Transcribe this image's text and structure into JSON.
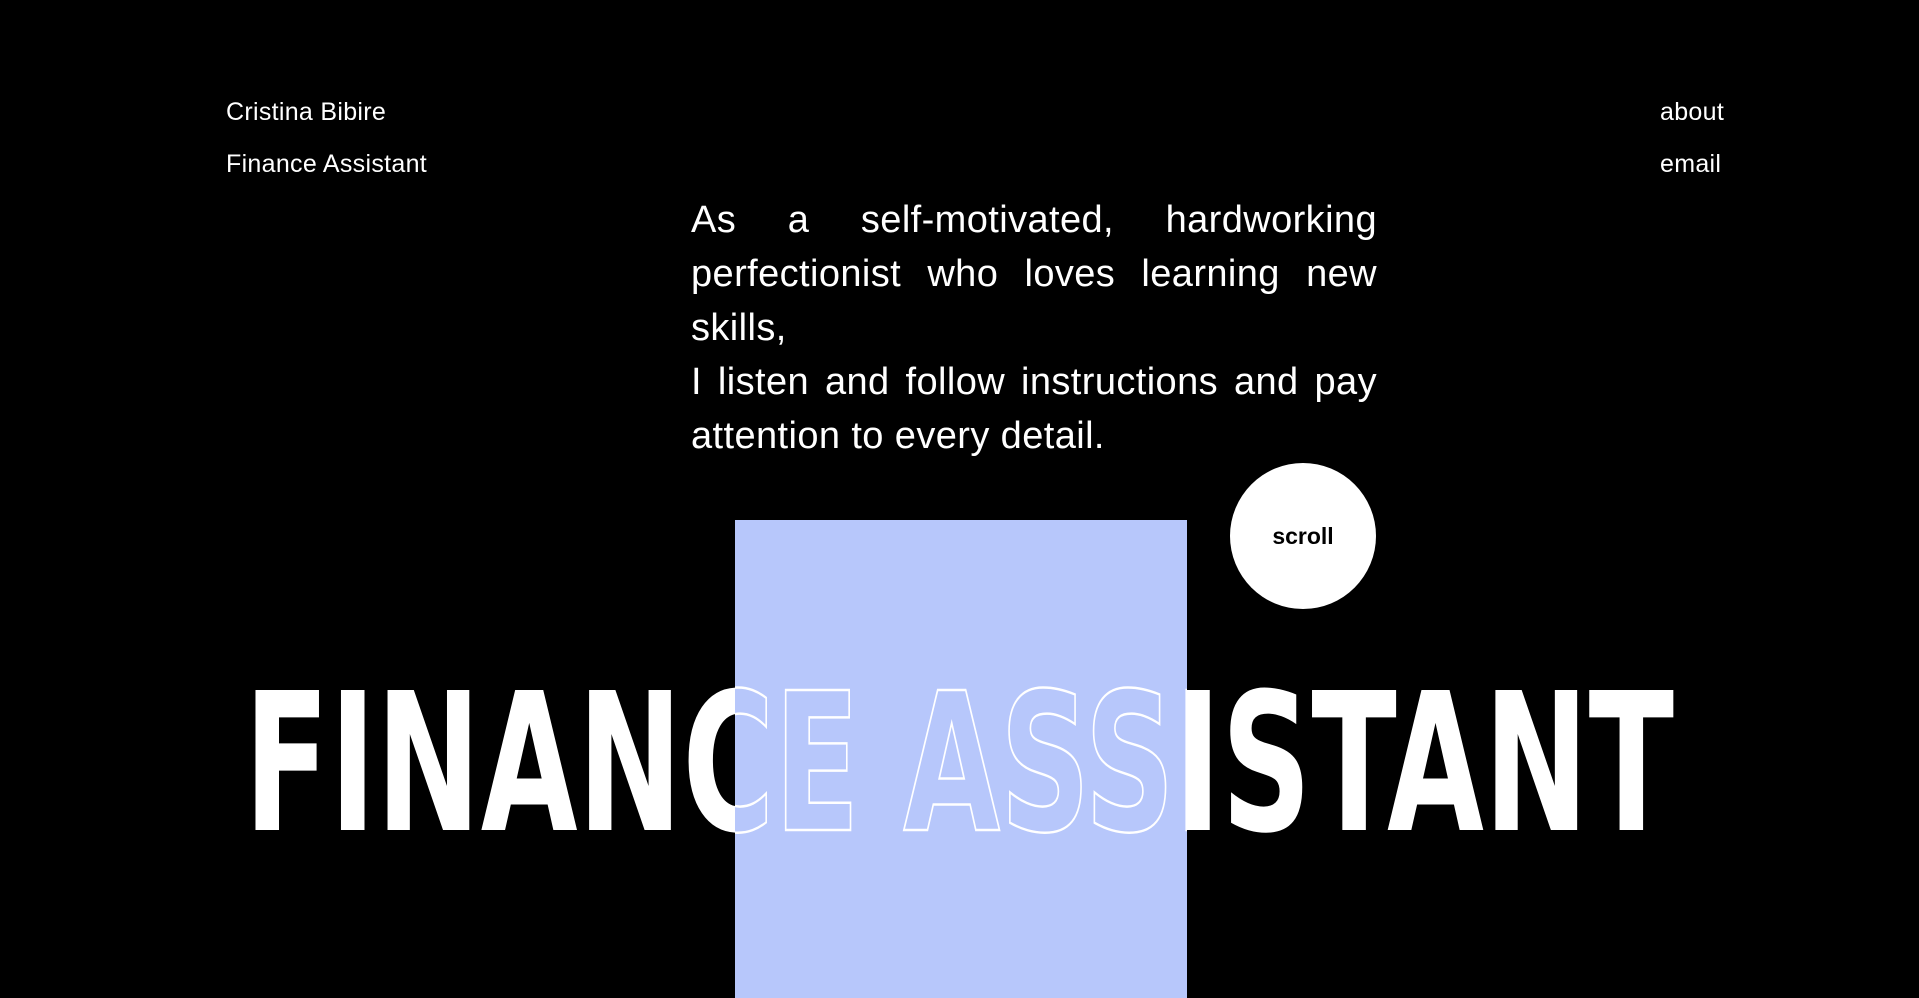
{
  "header": {
    "name": "Cristina Bibire",
    "role": "Finance Assistant"
  },
  "nav": {
    "about": "about",
    "email": "email"
  },
  "intro": {
    "line1": "As a self-motivated, hardworking perfectionist who loves learning new skills,",
    "line2": "I listen and follow instructions and pay attention to every detail."
  },
  "scroll_button": {
    "label": "scroll"
  },
  "headline": {
    "text": "FINANCE ASSISTANT"
  },
  "colors": {
    "background": "#000000",
    "text": "#ffffff",
    "accent_panel": "#b7c7fb"
  }
}
